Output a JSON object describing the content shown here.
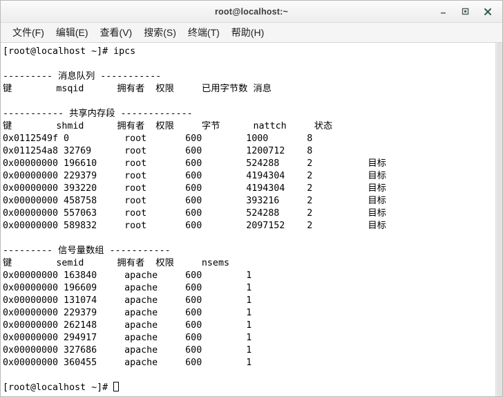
{
  "window": {
    "title": "root@localhost:~",
    "controls": [
      {
        "name": "minimize",
        "label": "–"
      },
      {
        "name": "maximize",
        "label": "□"
      },
      {
        "name": "close",
        "label": "✕"
      }
    ]
  },
  "menubar": {
    "items": [
      {
        "label": "文件(F)"
      },
      {
        "label": "编辑(E)"
      },
      {
        "label": "查看(V)"
      },
      {
        "label": "搜索(S)"
      },
      {
        "label": "终端(T)"
      },
      {
        "label": "帮助(H)"
      }
    ]
  },
  "terminal": {
    "prompt": "[root@localhost ~]# ",
    "command": "ipcs",
    "lines": [
      "[root@localhost ~]# ipcs",
      "",
      "--------- 消息队列 -----------",
      "键        msqid      拥有者  权限     已用字节数 消息",
      "",
      "----------- 共享内存段 -------------",
      "键        shmid      拥有者  权限     字节      nattch     状态",
      "0x0112549f 0          root       600        1000       8",
      "0x011254a8 32769      root       600        1200712    8",
      "0x00000000 196610     root       600        524288     2          目标",
      "0x00000000 229379     root       600        4194304    2          目标",
      "0x00000000 393220     root       600        4194304    2          目标",
      "0x00000000 458758     root       600        393216     2          目标",
      "0x00000000 557063     root       600        524288     2          目标",
      "0x00000000 589832     root       600        2097152    2          目标",
      "",
      "--------- 信号量数组 -----------",
      "键        semid      拥有者  权限     nsems",
      "0x00000000 163840     apache     600        1",
      "0x00000000 196609     apache     600        1",
      "0x00000000 131074     apache     600        1",
      "0x00000000 229379     apache     600        1",
      "0x00000000 262148     apache     600        1",
      "0x00000000 294917     apache     600        1",
      "0x00000000 327686     apache     600        1",
      "0x00000000 360455     apache     600        1",
      "",
      "[root@localhost ~]# "
    ],
    "sections": {
      "message_queues": {
        "header": "--------- 消息队列 -----------",
        "columns": [
          "键",
          "msqid",
          "拥有者",
          "权限",
          "已用字节数",
          "消息"
        ],
        "rows": []
      },
      "shared_memory": {
        "header": "----------- 共享内存段 -------------",
        "columns": [
          "键",
          "shmid",
          "拥有者",
          "权限",
          "字节",
          "nattch",
          "状态"
        ],
        "rows": [
          [
            "0x0112549f",
            "0",
            "root",
            "600",
            "1000",
            "8",
            ""
          ],
          [
            "0x011254a8",
            "32769",
            "root",
            "600",
            "1200712",
            "8",
            ""
          ],
          [
            "0x00000000",
            "196610",
            "root",
            "600",
            "524288",
            "2",
            "目标"
          ],
          [
            "0x00000000",
            "229379",
            "root",
            "600",
            "4194304",
            "2",
            "目标"
          ],
          [
            "0x00000000",
            "393220",
            "root",
            "600",
            "4194304",
            "2",
            "目标"
          ],
          [
            "0x00000000",
            "458758",
            "root",
            "600",
            "393216",
            "2",
            "目标"
          ],
          [
            "0x00000000",
            "557063",
            "root",
            "600",
            "524288",
            "2",
            "目标"
          ],
          [
            "0x00000000",
            "589832",
            "root",
            "600",
            "2097152",
            "2",
            "目标"
          ]
        ]
      },
      "semaphore_arrays": {
        "header": "--------- 信号量数组 -----------",
        "columns": [
          "键",
          "semid",
          "拥有者",
          "权限",
          "nsems"
        ],
        "rows": [
          [
            "0x00000000",
            "163840",
            "apache",
            "600",
            "1"
          ],
          [
            "0x00000000",
            "196609",
            "apache",
            "600",
            "1"
          ],
          [
            "0x00000000",
            "131074",
            "apache",
            "600",
            "1"
          ],
          [
            "0x00000000",
            "229379",
            "apache",
            "600",
            "1"
          ],
          [
            "0x00000000",
            "262148",
            "apache",
            "600",
            "1"
          ],
          [
            "0x00000000",
            "294917",
            "apache",
            "600",
            "1"
          ],
          [
            "0x00000000",
            "327686",
            "apache",
            "600",
            "1"
          ],
          [
            "0x00000000",
            "360455",
            "apache",
            "600",
            "1"
          ]
        ]
      }
    }
  },
  "colors": {
    "titlebar_bg": "#f3f3f3",
    "menubar_bg": "#f5f5f5",
    "terminal_bg": "#ffffff",
    "terminal_fg": "#000000",
    "border": "#b8b8b8"
  }
}
